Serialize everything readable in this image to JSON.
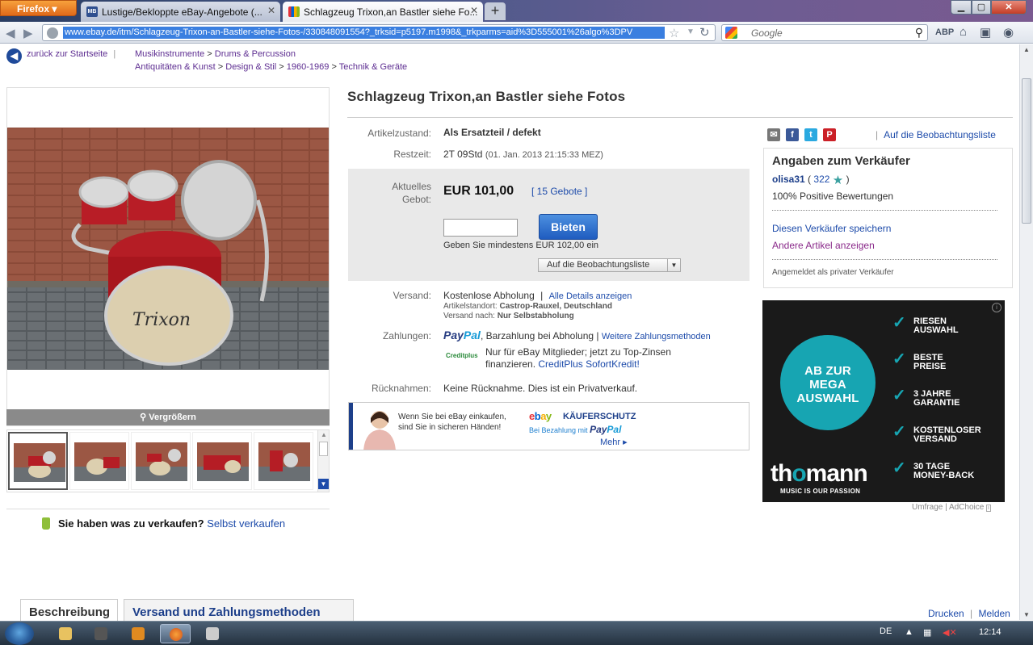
{
  "browser": {
    "menu_button": "Firefox",
    "tabs": [
      {
        "icon_text": "MB",
        "title": "Lustige/Bekloppte eBay-Angebote (..."
      },
      {
        "icon_text": "",
        "title": "Schlagzeug Trixon,an Bastler siehe Fo..."
      }
    ],
    "new_tab": "+",
    "url": "www.ebay.de/itm/Schlagzeug-Trixon-an-Bastler-siehe-Fotos-/330848091554?_trksid=p5197.m1998&_trkparms=aid%3D555001%26algo%3DPV",
    "search_placeholder": "Google"
  },
  "breadcrumb": {
    "back_label": "zurück zur Startseite",
    "sep": "|",
    "path1": [
      "Musikinstrumente",
      "Drums & Percussion"
    ],
    "path2": [
      "Antiquitäten & Kunst",
      "Design & Stil",
      "1960-1969",
      "Technik & Geräte"
    ],
    "arrow": ">"
  },
  "gallery": {
    "enlarge_label": "Vergrößern",
    "thumb_count": 5
  },
  "sell": {
    "question": "Sie haben was zu verkaufen?",
    "link": "Selbst verkaufen"
  },
  "item": {
    "title": "Schlagzeug Trixon,an Bastler siehe Fotos",
    "condition_label": "Artikelzustand:",
    "condition_value": "Als Ersatzteil / defekt",
    "time_label": "Restzeit:",
    "time_value": "2T 09Std",
    "time_detail": "(01. Jan. 2013 21:15:33 MEZ)",
    "bid_label_1": "Aktuelles",
    "bid_label_2": "Gebot:",
    "price": "EUR 101,00",
    "bids": "[ 15 Gebote ]",
    "bid_button": "Bieten",
    "bid_hint": "Geben Sie mindestens EUR 102,00 ein",
    "watch_button": "Auf die Beobachtungsliste",
    "shipping_label": "Versand:",
    "shipping_value": "Kostenlose Abholung",
    "shipping_sep": "|",
    "shipping_details_link": "Alle Details anzeigen",
    "location_label": "Artikelstandort:",
    "location_value": "Castrop-Rauxel, Deutschland",
    "ships_to_label": "Versand nach:",
    "ships_to_value": "Nur Selbstabholung",
    "payment_label": "Zahlungen:",
    "payment_paypal_1": "Pay",
    "payment_paypal_2": "Pal",
    "payment_value": ", Barzahlung bei Abholung |",
    "payment_more_link": "Weitere Zahlungsmethoden",
    "creditplus_logo": "Creditplus",
    "creditplus_text_1": "Nur für eBay Mitglieder; jetzt zu Top-Zinsen",
    "creditplus_text_2": "finanzieren.",
    "creditplus_link": "CreditPlus SofortKredit!",
    "returns_label": "Rücknahmen:",
    "returns_value": "Keine Rücknahme. Dies ist ein Privatverkauf."
  },
  "buyer_protection": {
    "line1": "Wenn Sie bei eBay einkaufen,",
    "line2": "sind Sie in sicheren Händen!",
    "logo_e": "e",
    "logo_b": "b",
    "logo_a": "a",
    "logo_y": "y",
    "title": "KÄUFERSCHUTZ",
    "with_text": "Bei Bezahlung mit",
    "paypal_1": "Pay",
    "paypal_2": "Pal",
    "more": "Mehr ▸"
  },
  "share": {
    "sep": "|",
    "watch_link": "Auf die Beobachtungsliste",
    "colors": {
      "mail": "#777777",
      "facebook": "#3b5998",
      "twitter": "#2aa9e0",
      "pinterest": "#cb2027"
    }
  },
  "seller": {
    "heading": "Angaben zum Verkäufer",
    "name": "olisa31",
    "rating_open": "(",
    "rating": "322",
    "rating_close": ")",
    "positive": "100% Positive Bewertungen",
    "save_link": "Diesen Verkäufer speichern",
    "other_items_link": "Andere Artikel anzeigen",
    "account_type": "Angemeldet als privater Verkäufer"
  },
  "ad": {
    "circle_1": "AB ZUR",
    "circle_2": "MEGA",
    "circle_3": "AUSWAHL",
    "brand_1": "th",
    "brand_dot": "o",
    "brand_2": "mann",
    "slogan": "MUSIC IS OUR PASSION",
    "features": [
      {
        "l1": "RIESEN",
        "l2": "AUSWAHL"
      },
      {
        "l1": "BESTE",
        "l2": "PREISE"
      },
      {
        "l1": "3 JAHRE",
        "l2": "GARANTIE"
      },
      {
        "l1": "KOSTENLOSER",
        "l2": "VERSAND"
      },
      {
        "l1": "30 TAGE",
        "l2": "MONEY-BACK"
      }
    ],
    "accent": "#17a5b2",
    "adchoice": "Umfrage | AdChoice"
  },
  "bottom_tabs": {
    "description": "Beschreibung",
    "shipping": "Versand und Zahlungsmethoden"
  },
  "footer": {
    "print": "Drucken",
    "sep": "|",
    "report": "Melden"
  },
  "taskbar": {
    "lang": "DE",
    "time": "12:14"
  }
}
